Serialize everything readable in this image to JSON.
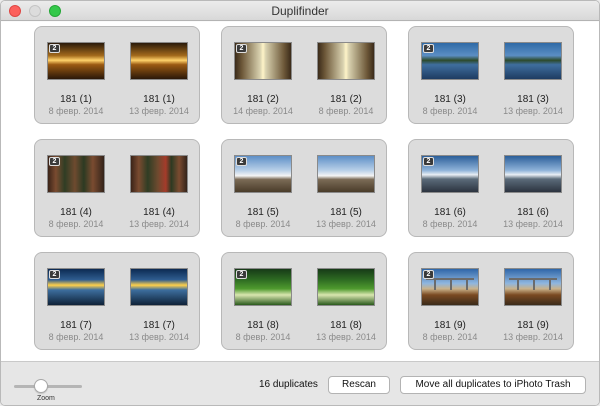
{
  "window": {
    "title": "Duplifinder"
  },
  "groups": [
    {
      "count": "2",
      "items": [
        {
          "name": "181 (1)",
          "date": "8 февр. 2014",
          "img": "img-sunset"
        },
        {
          "name": "181 (1)",
          "date": "13 февр. 2014",
          "img": "img-sunset"
        }
      ]
    },
    {
      "count": "2",
      "items": [
        {
          "name": "181 (2)",
          "date": "14 февр. 2014",
          "img": "img-forest"
        },
        {
          "name": "181 (2)",
          "date": "8 февр. 2014",
          "img": "img-forest"
        }
      ]
    },
    {
      "count": "2",
      "items": [
        {
          "name": "181 (3)",
          "date": "8 февр. 2014",
          "img": "img-lake"
        },
        {
          "name": "181 (3)",
          "date": "13 февр. 2014",
          "img": "img-lake"
        }
      ]
    },
    {
      "count": "2",
      "items": [
        {
          "name": "181 (4)",
          "date": "8 февр. 2014",
          "img": "img-redwood"
        },
        {
          "name": "181 (4)",
          "date": "13 февр. 2014",
          "img": "img-redwood-r"
        }
      ]
    },
    {
      "count": "2",
      "items": [
        {
          "name": "181 (5)",
          "date": "8 февр. 2014",
          "img": "img-mtn"
        },
        {
          "name": "181 (5)",
          "date": "13 февр. 2014",
          "img": "img-mtn"
        }
      ]
    },
    {
      "count": "2",
      "items": [
        {
          "name": "181 (6)",
          "date": "8 февр. 2014",
          "img": "img-mtn2"
        },
        {
          "name": "181 (6)",
          "date": "13 февр. 2014",
          "img": "img-mtn2"
        }
      ]
    },
    {
      "count": "2",
      "items": [
        {
          "name": "181 (7)",
          "date": "8 февр. 2014",
          "img": "img-coast"
        },
        {
          "name": "181 (7)",
          "date": "13 февр. 2014",
          "img": "img-coast"
        }
      ]
    },
    {
      "count": "2",
      "items": [
        {
          "name": "181 (8)",
          "date": "8 февр. 2014",
          "img": "img-green"
        },
        {
          "name": "181 (8)",
          "date": "13 февр. 2014",
          "img": "img-green"
        }
      ]
    },
    {
      "count": "2",
      "items": [
        {
          "name": "181 (9)",
          "date": "8 февр. 2014",
          "img": "img-bridge"
        },
        {
          "name": "181 (9)",
          "date": "13 февр. 2014",
          "img": "img-bridge"
        }
      ]
    }
  ],
  "footer": {
    "zoom_label": "Zoom",
    "zoom_level": 0.4,
    "duplicates_count": "16 duplicates",
    "rescan_label": "Rescan",
    "trash_label": "Move all duplicates to iPhoto Trash"
  }
}
